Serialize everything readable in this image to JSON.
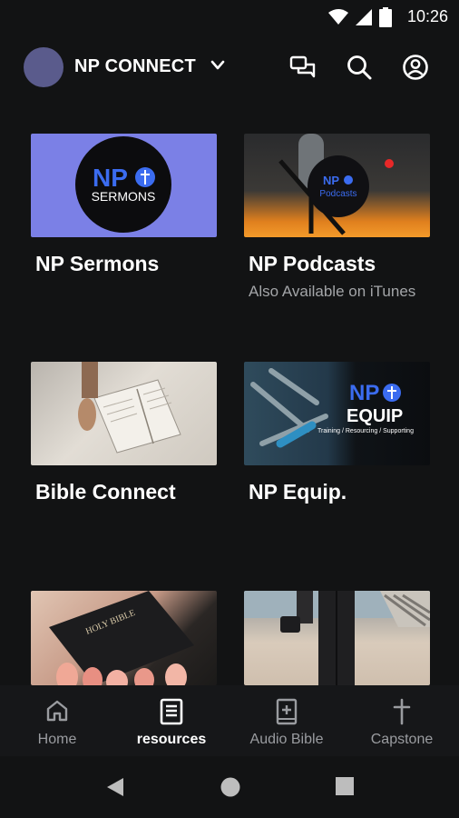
{
  "status": {
    "time": "10:26",
    "wifi_icon": "wifi-icon",
    "signal_icon": "cell-signal-icon",
    "battery_icon": "battery-icon"
  },
  "header": {
    "title": "NP CONNECT",
    "chat_icon": "chat-icon",
    "search_icon": "search-icon",
    "account_icon": "account-icon"
  },
  "cards": [
    {
      "title": "NP Sermons",
      "subtitle": "",
      "thumb_text": "NP",
      "thumb_sub": "SERMONS"
    },
    {
      "title": "NP Podcasts",
      "subtitle": "Also Available on iTunes",
      "thumb_text": "NP",
      "thumb_sub": "Podcasts"
    },
    {
      "title": "Bible Connect",
      "subtitle": ""
    },
    {
      "title": "NP Equip.",
      "subtitle": "",
      "thumb_text": "NP",
      "thumb_sub": "EQUIP",
      "thumb_tag": "Training / Resourcing / Supporting"
    },
    {
      "title": "",
      "subtitle": "",
      "thumb_text": "HOLY BIBLE"
    },
    {
      "title": "",
      "subtitle": ""
    }
  ],
  "nav": [
    {
      "label": "Home",
      "icon": "home-icon"
    },
    {
      "label": "resources",
      "icon": "book-icon",
      "active": true
    },
    {
      "label": "Audio Bible",
      "icon": "bible-plus-icon"
    },
    {
      "label": "Capstone",
      "icon": "cross-icon"
    }
  ],
  "colors": {
    "background": "#121314",
    "avatar": "#5a5b8c",
    "sermons_bg": "#7b80e6",
    "accent_blue": "#3b6cf0",
    "muted_text": "#a3a5a8"
  }
}
